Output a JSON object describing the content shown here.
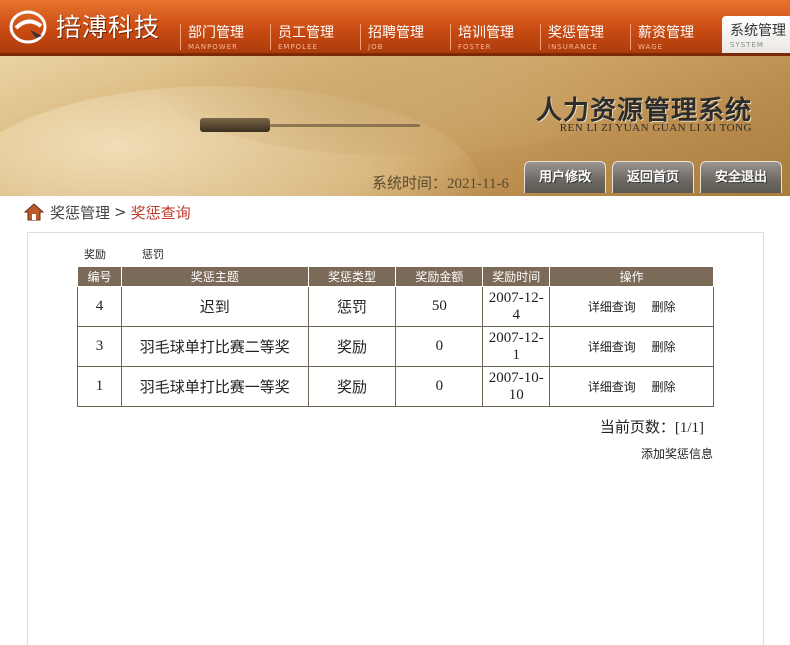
{
  "brand": {
    "name": "掊溥科技"
  },
  "nav": [
    {
      "cn": "部门管理",
      "en": "MANPOWER",
      "active": false
    },
    {
      "cn": "员工管理",
      "en": "EMPOLEE",
      "active": false
    },
    {
      "cn": "招聘管理",
      "en": "JOB",
      "active": false
    },
    {
      "cn": "培训管理",
      "en": "FOSTER",
      "active": false
    },
    {
      "cn": "奖惩管理",
      "en": "INSURANCE",
      "active": false
    },
    {
      "cn": "薪资管理",
      "en": "WAGE",
      "active": false
    },
    {
      "cn": "系统管理",
      "en": "SYSTEM",
      "active": true
    }
  ],
  "banner": {
    "title": "人力资源管理系统",
    "subtitle": "REN LI ZI YUAN GUAN LI XI TONG",
    "time_label": "系统时间：2021-11-6",
    "buttons": [
      "用户修改",
      "返回首页",
      "安全退出"
    ]
  },
  "breadcrumb": {
    "parent": "奖惩管理",
    "sep": ">",
    "current": "奖惩查询"
  },
  "tabs": [
    "奖励",
    "惩罚"
  ],
  "table": {
    "headers": [
      "编号",
      "奖惩主题",
      "奖惩类型",
      "奖励金额",
      "奖励时间",
      "操作"
    ],
    "rows": [
      {
        "id": "4",
        "subject": "迟到",
        "type": "惩罚",
        "amount": "50",
        "date_a": "2007-12-",
        "date_b": "4",
        "op_view": "详细查询",
        "op_del": "删除"
      },
      {
        "id": "3",
        "subject": "羽毛球单打比赛二等奖",
        "type": "奖励",
        "amount": "0",
        "date_a": "2007-12-",
        "date_b": "1",
        "op_view": "详细查询",
        "op_del": "删除"
      },
      {
        "id": "1",
        "subject": "羽毛球单打比赛一等奖",
        "type": "奖励",
        "amount": "0",
        "date_a": "2007-10-",
        "date_b": "10",
        "op_view": "详细查询",
        "op_del": "删除"
      }
    ]
  },
  "pager": {
    "text": "当前页数：[1/1]"
  },
  "add_link": "添加奖惩信息",
  "colors": {
    "nav_orange": "#c94a12",
    "table_header": "#7a6a57",
    "crumb_current": "#c0392b"
  }
}
